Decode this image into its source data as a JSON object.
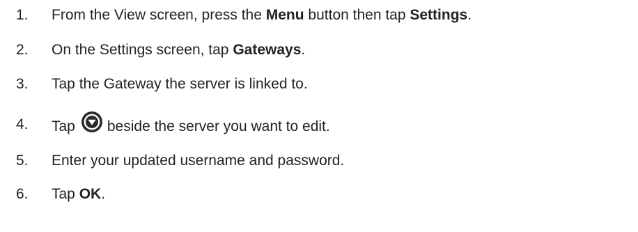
{
  "steps": [
    {
      "number": "1.",
      "parts": [
        "From the View screen, press the ",
        "Menu",
        " button then tap ",
        "Settings",
        "."
      ]
    },
    {
      "number": "2.",
      "parts": [
        "On the Settings screen, tap ",
        "Gateways",
        "."
      ]
    },
    {
      "number": "3.",
      "parts": [
        "Tap the Gateway the server is linked to."
      ]
    },
    {
      "number": "4.",
      "parts": [
        "Tap",
        "beside the server you want to edit."
      ],
      "icon": "expand-down-circle-icon"
    },
    {
      "number": "5.",
      "parts": [
        "Enter your updated username and password."
      ]
    },
    {
      "number": "6.",
      "parts": [
        "Tap ",
        "OK",
        "."
      ]
    }
  ],
  "colors": {
    "text": "#222222",
    "icon_fill": "#2b2b2b",
    "background": "#ffffff"
  }
}
